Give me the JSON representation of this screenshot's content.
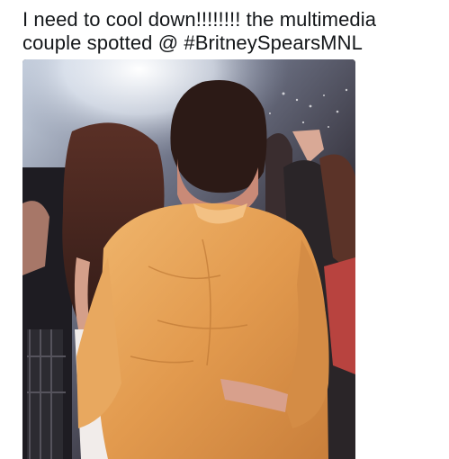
{
  "tweet": {
    "text_line_1": "I need to cool down!!!!!!!! the multimedia",
    "text_line_2": "couple spotted @ #BritneySpearsMNL"
  },
  "media": {
    "alt": "Photo of a couple viewed from behind at a concert, man in an orange jacket with his arm around a long-haired woman",
    "colors": {
      "stage_light": "#f4f7fb",
      "crowd_dark": "#2a2630",
      "jacket": "#e3a25a",
      "hair_man": "#2c1a16",
      "hair_woman": "#4a2a22",
      "skin": "#d8a08c"
    }
  }
}
